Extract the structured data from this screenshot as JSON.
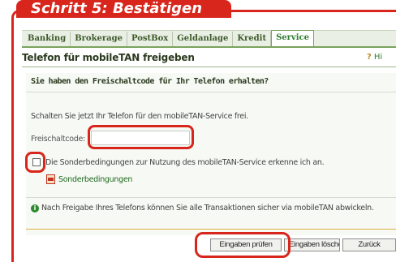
{
  "step_tab": {
    "label": "Schritt 5: Bestätigen"
  },
  "nav": {
    "items": [
      "Banking",
      "Brokerage",
      "PostBox",
      "Geldanlage",
      "Kredit",
      "Service"
    ],
    "active": "Service"
  },
  "page": {
    "title": "Telefon für mobileTAN freigeben",
    "help_label": "Hi"
  },
  "form": {
    "question": "Sie haben den Freischaltcode für Ihr Telefon erhalten?",
    "intro": "Schalten Sie jetzt Ihr Telefon für den mobileTAN-Service frei.",
    "code_label": "Freischaltcode:",
    "code_value": "",
    "checkbox_checked": false,
    "terms_text": "Die Sonderbedingungen zur Nutzung des mobileTAN-Service erkenne ich an.",
    "terms_link": "Sonderbedingungen",
    "info_text": "Nach Freigabe Ihres Telefons können Sie alle Transaktionen sicher via mobileTAN abwickeln."
  },
  "buttons": {
    "check": "Eingaben prüfen",
    "clear": "Eingaben löschen",
    "back": "Zurück"
  },
  "colors": {
    "highlight": "#d8261c",
    "nav_active": "#2e7d2e",
    "info": "#2e8b2e"
  },
  "icons": [
    "help-icon",
    "pdf-icon",
    "info-icon"
  ]
}
